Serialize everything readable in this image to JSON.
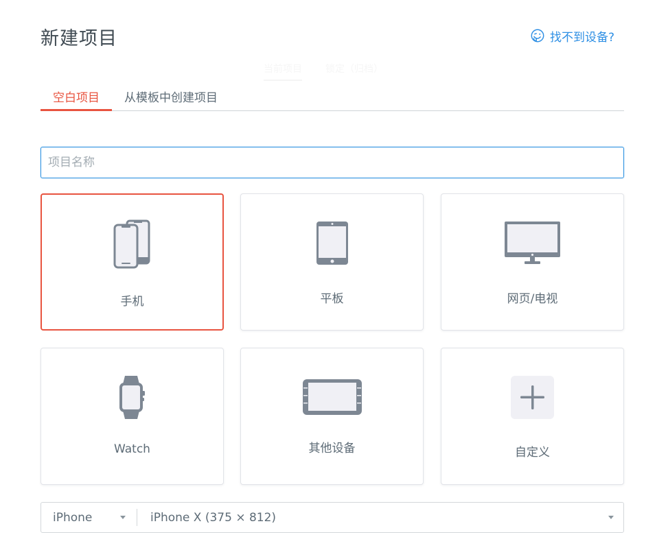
{
  "header": {
    "title": "新建项目",
    "help_link": "找不到设备?",
    "help_icon": "confused-face-icon"
  },
  "ghost_tabs": [
    {
      "label": "当前项目",
      "active": true
    },
    {
      "label": "锁定（归档）",
      "active": false
    }
  ],
  "tabs": [
    {
      "label": "空白项目",
      "active": true
    },
    {
      "label": "从模板中创建项目",
      "active": false
    }
  ],
  "name_input": {
    "placeholder": "项目名称",
    "value": ""
  },
  "devices": [
    {
      "label": "手机",
      "icon": "phone-icon",
      "selected": true
    },
    {
      "label": "平板",
      "icon": "tablet-icon",
      "selected": false
    },
    {
      "label": "网页/电视",
      "icon": "monitor-icon",
      "selected": false
    },
    {
      "label": "Watch",
      "icon": "watch-icon",
      "selected": false
    },
    {
      "label": "其他设备",
      "icon": "other-device-icon",
      "selected": false
    },
    {
      "label": "自定义",
      "icon": "plus-icon",
      "selected": false
    }
  ],
  "device_select": {
    "family": "iPhone",
    "model": "iPhone X (375 × 812)"
  },
  "colors": {
    "accent": "#e8533f",
    "link": "#2e8fe4",
    "focus": "#2c91e0",
    "icon_stroke": "#7d8793",
    "icon_fill": "#f0f0f5"
  }
}
